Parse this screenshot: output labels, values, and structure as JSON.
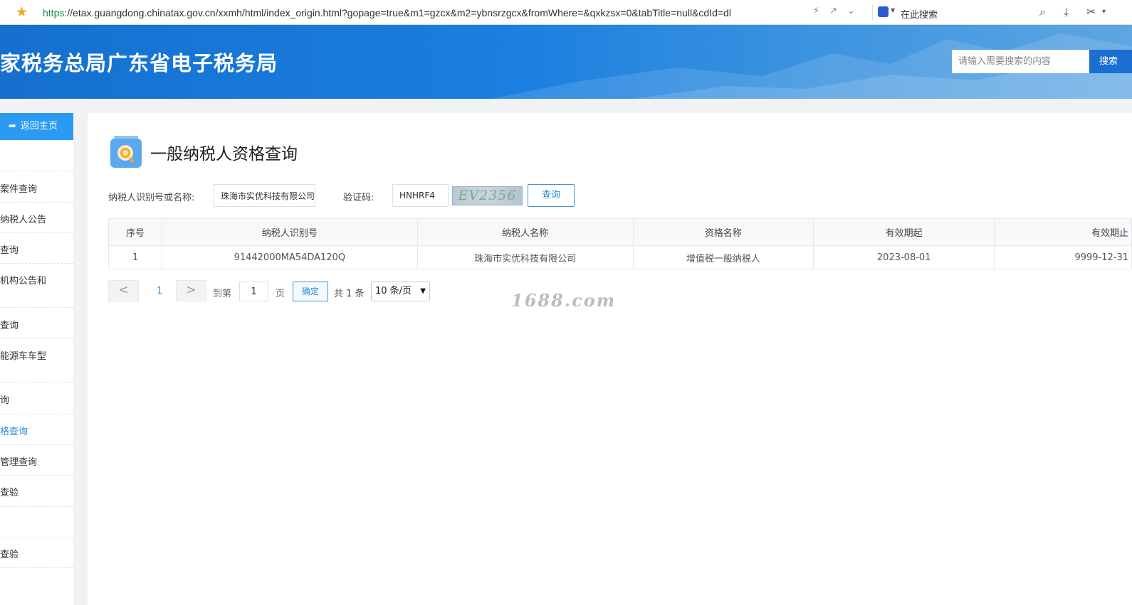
{
  "browser": {
    "url_protocol": "https",
    "url_rest": "://etax.guangdong.chinatax.gov.cn/xxmh/html/index_origin.html?gopage=true&m1=gzcx&m2=ybnsrzgcx&fromWhere=&qxkzsx=0&tabTitle=null&cdId=dl",
    "search_label": "在此搜索"
  },
  "header": {
    "site_title": "家税务总局广东省电子税务局",
    "search_placeholder": "请输入需要搜索的内容",
    "search_button": "搜索"
  },
  "sidebar": {
    "back_label": "返回主页",
    "items": [
      {
        "label": ""
      },
      {
        "label": "案件查询"
      },
      {
        "label": "纳税人公告"
      },
      {
        "label": "查询"
      },
      {
        "label": "机构公告和"
      },
      {
        "label": "查询"
      },
      {
        "label": "能源车车型"
      },
      {
        "label": "询"
      },
      {
        "label": "格查询"
      },
      {
        "label": "管理查询"
      },
      {
        "label": "查验"
      },
      {
        "label": ""
      },
      {
        "label": "查验"
      }
    ]
  },
  "page": {
    "title": "一般纳税人资格查询"
  },
  "form": {
    "taxpayer_label": "纳税人识别号或名称:",
    "taxpayer_value": "珠海市实优科技有限公司",
    "captcha_label": "验证码:",
    "captcha_input": "HNHRF4",
    "captcha_image_text": "EV2356",
    "query_button": "查询"
  },
  "table": {
    "headers": [
      "序号",
      "纳税人识别号",
      "纳税人名称",
      "资格名称",
      "有效期起",
      "有效期止"
    ],
    "rows": [
      [
        "1",
        "91442000MA54DA120Q",
        "珠海市实优科技有限公司",
        "增值税一般纳税人",
        "2023-08-01",
        "9999-12-31"
      ]
    ]
  },
  "pager": {
    "prev": "<",
    "current_page": "1",
    "next": ">",
    "goto_label": "到第",
    "goto_value": "1",
    "page_unit": "页",
    "confirm": "确定",
    "total": "共 1 条",
    "page_size": "10 条/页"
  },
  "watermark": "1688.com"
}
